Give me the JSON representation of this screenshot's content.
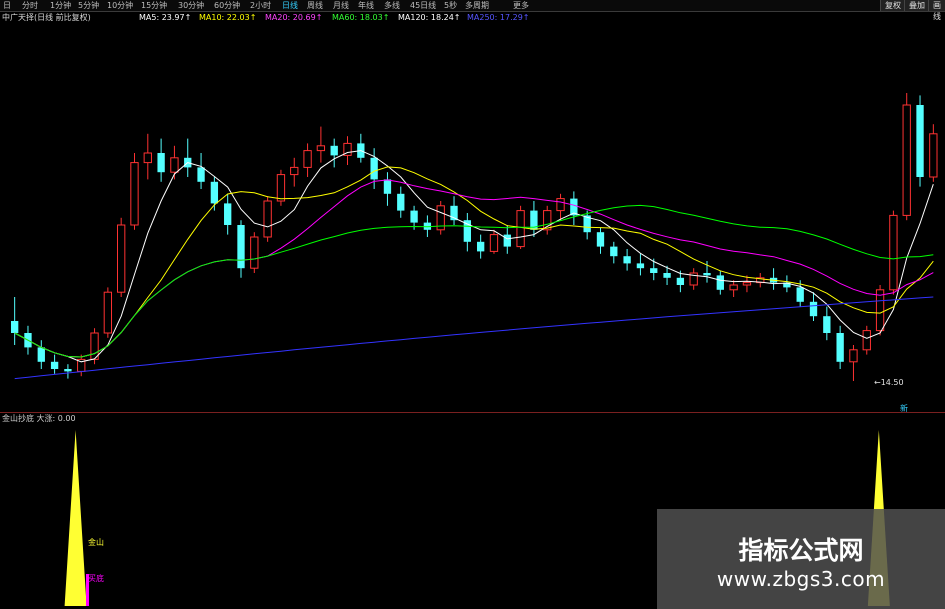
{
  "toolbar": {
    "tabs": [
      "日",
      "分时",
      "1分钟",
      "5分钟",
      "10分钟",
      "15分钟",
      "30分钟",
      "60分钟",
      "2小时",
      "日线",
      "周线",
      "月线",
      "年线",
      "多线",
      "45日线",
      "5秒",
      "多周期",
      "更多"
    ],
    "active_tab": "日线",
    "restore_label": "复权",
    "overlay_label": "叠加",
    "draw_label": "画线"
  },
  "header": {
    "title": "中广天择(日线 前比复权)",
    "ma5": "MA5: 23.97↑",
    "ma10": "MA10: 22.03↑",
    "ma20": "MA20: 20.69↑",
    "ma60": "MA60: 18.03↑",
    "ma120": "MA120: 18.24↑",
    "ma250": "MA250: 17.29↑",
    "colors": {
      "ma5": "#ffffff",
      "ma10": "#ffff00",
      "ma20": "#ff00ff",
      "ma60": "#00ff00",
      "ma120": "#ffffff",
      "ma250": "#3333ff"
    }
  },
  "price_labels": {
    "low_label": "←14.50",
    "date_marker": "新"
  },
  "indicator": {
    "title": "金山抄底 大涨: 0.00",
    "gold_label": "金山",
    "buy_label": "买底"
  },
  "watermark": {
    "title": "指标公式网",
    "url": "www.zbgs3.com"
  },
  "chart_data": {
    "type": "candlestick",
    "up_color": "#ff3232",
    "down_color": "#54ffff",
    "ylim": [
      14,
      29
    ],
    "candles": [
      [
        17.0,
        18.0,
        16.0,
        16.5
      ],
      [
        16.5,
        16.8,
        15.6,
        15.9
      ],
      [
        15.9,
        16.2,
        15.0,
        15.3
      ],
      [
        15.3,
        15.6,
        14.8,
        15.0
      ],
      [
        15.0,
        15.2,
        14.6,
        14.9
      ],
      [
        14.9,
        15.6,
        14.7,
        15.4
      ],
      [
        15.4,
        16.7,
        15.2,
        16.5
      ],
      [
        16.5,
        18.4,
        16.3,
        18.2
      ],
      [
        18.2,
        21.3,
        18.0,
        21.0
      ],
      [
        21.0,
        24.0,
        20.8,
        23.6
      ],
      [
        23.6,
        24.8,
        22.9,
        24.0
      ],
      [
        24.0,
        24.6,
        22.8,
        23.2
      ],
      [
        23.2,
        24.3,
        22.9,
        23.8
      ],
      [
        23.8,
        24.6,
        23.0,
        23.4
      ],
      [
        23.4,
        24.0,
        22.5,
        22.8
      ],
      [
        22.8,
        23.0,
        21.6,
        21.9
      ],
      [
        21.9,
        22.3,
        20.6,
        21.0
      ],
      [
        21.0,
        21.2,
        18.8,
        19.2
      ],
      [
        19.2,
        20.7,
        19.0,
        20.5
      ],
      [
        20.5,
        22.2,
        20.3,
        22.0
      ],
      [
        22.0,
        23.3,
        21.8,
        23.1
      ],
      [
        23.1,
        23.8,
        22.6,
        23.4
      ],
      [
        23.4,
        24.4,
        23.0,
        24.1
      ],
      [
        24.1,
        25.1,
        23.6,
        24.3
      ],
      [
        24.3,
        24.6,
        23.4,
        23.9
      ],
      [
        23.9,
        24.7,
        23.5,
        24.4
      ],
      [
        24.4,
        24.8,
        23.6,
        23.8
      ],
      [
        23.8,
        24.2,
        22.5,
        22.9
      ],
      [
        22.9,
        23.2,
        21.8,
        22.3
      ],
      [
        22.3,
        22.6,
        21.3,
        21.6
      ],
      [
        21.6,
        21.8,
        20.8,
        21.1
      ],
      [
        21.1,
        21.4,
        20.5,
        20.8
      ],
      [
        20.8,
        22.0,
        20.6,
        21.8
      ],
      [
        21.8,
        22.2,
        21.0,
        21.2
      ],
      [
        21.2,
        21.5,
        19.9,
        20.3
      ],
      [
        20.3,
        20.6,
        19.6,
        19.9
      ],
      [
        19.9,
        20.8,
        19.8,
        20.6
      ],
      [
        20.6,
        21.0,
        19.8,
        20.1
      ],
      [
        20.1,
        21.8,
        20.0,
        21.6
      ],
      [
        21.6,
        22.0,
        20.5,
        20.8
      ],
      [
        20.8,
        21.8,
        20.6,
        21.6
      ],
      [
        21.6,
        22.3,
        21.2,
        22.1
      ],
      [
        22.1,
        22.4,
        21.0,
        21.4
      ],
      [
        21.4,
        21.6,
        20.4,
        20.7
      ],
      [
        20.7,
        20.9,
        19.8,
        20.1
      ],
      [
        20.1,
        20.3,
        19.4,
        19.7
      ],
      [
        19.7,
        20.0,
        19.1,
        19.4
      ],
      [
        19.4,
        19.8,
        18.9,
        19.2
      ],
      [
        19.2,
        19.6,
        18.7,
        19.0
      ],
      [
        19.0,
        19.3,
        18.5,
        18.8
      ],
      [
        18.8,
        19.1,
        18.2,
        18.5
      ],
      [
        18.5,
        19.2,
        18.3,
        19.0
      ],
      [
        19.0,
        19.5,
        18.6,
        18.9
      ],
      [
        18.9,
        19.1,
        18.1,
        18.3
      ],
      [
        18.3,
        18.7,
        18.0,
        18.5
      ],
      [
        18.5,
        18.9,
        18.2,
        18.6
      ],
      [
        18.6,
        19.0,
        18.4,
        18.8
      ],
      [
        18.8,
        19.2,
        18.3,
        18.6
      ],
      [
        18.6,
        18.9,
        18.2,
        18.4
      ],
      [
        18.4,
        18.7,
        17.6,
        17.8
      ],
      [
        17.8,
        18.2,
        17.0,
        17.2
      ],
      [
        17.2,
        17.6,
        16.2,
        16.5
      ],
      [
        16.5,
        16.8,
        15.0,
        15.3
      ],
      [
        15.3,
        16.0,
        14.5,
        15.8
      ],
      [
        15.8,
        16.8,
        15.6,
        16.6
      ],
      [
        16.6,
        18.5,
        16.4,
        18.3
      ],
      [
        18.3,
        21.6,
        18.1,
        21.4
      ],
      [
        21.4,
        26.5,
        21.2,
        26.0
      ],
      [
        26.0,
        26.4,
        22.6,
        23.0
      ],
      [
        23.0,
        25.2,
        22.8,
        24.8
      ]
    ],
    "ma_series": [
      {
        "name": "MA5",
        "color": "#ffffff"
      },
      {
        "name": "MA10",
        "color": "#ffff00"
      },
      {
        "name": "MA20",
        "color": "#ff00ff"
      },
      {
        "name": "MA60",
        "color": "#00ff00"
      },
      {
        "name": "MA250",
        "color": "#3333ff"
      }
    ],
    "indicator_peaks": [
      {
        "center": 0.08,
        "height": 1.0
      },
      {
        "center": 0.93,
        "height": 1.0
      }
    ]
  }
}
